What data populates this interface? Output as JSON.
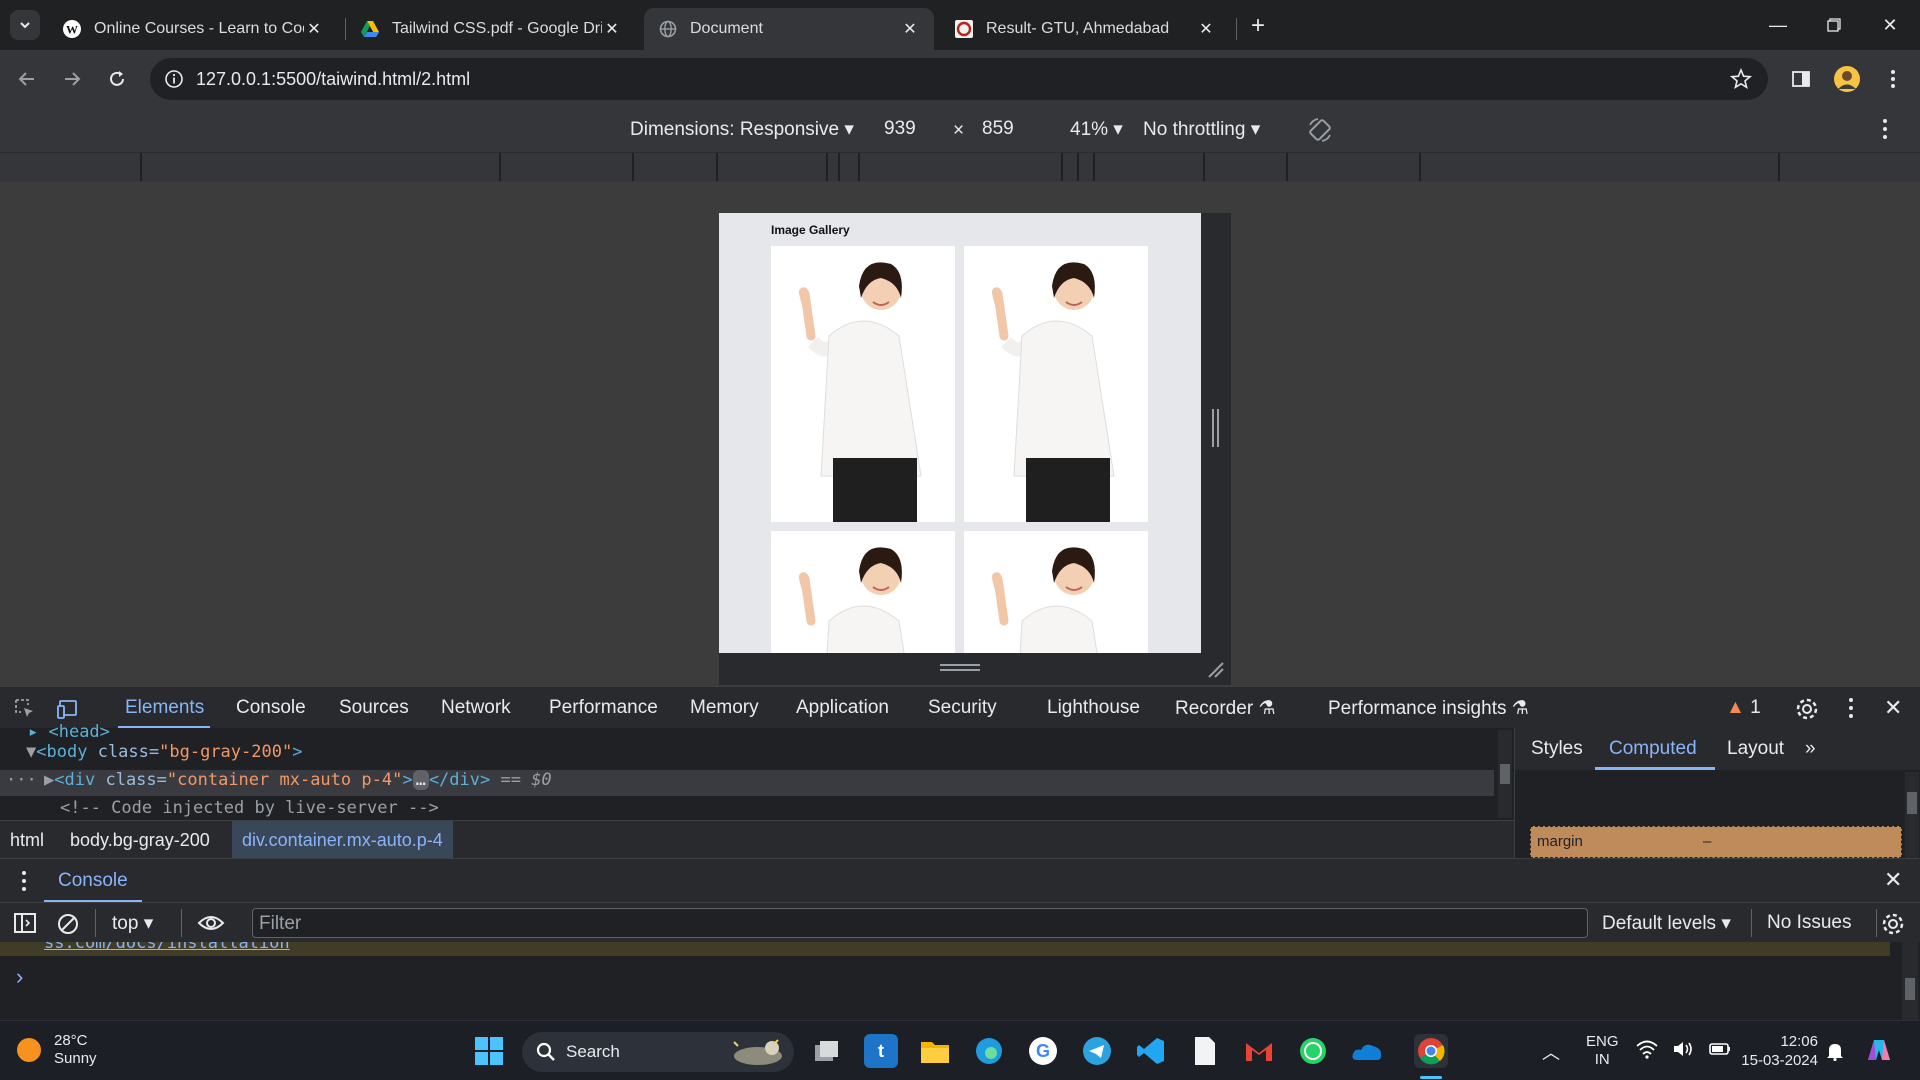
{
  "browser": {
    "tabs": [
      {
        "title": "Online Courses - Learn to Code",
        "favicon": "wordpress-icon"
      },
      {
        "title": "Tailwind CSS.pdf - Google Drive",
        "favicon": "google-drive-icon"
      },
      {
        "title": "Document",
        "favicon": "globe-icon",
        "active": true
      },
      {
        "title": "Result- GTU, Ahmedabad",
        "favicon": "gtu-icon"
      }
    ],
    "url": "127.0.0.1:5500/taiwind.html/2.html"
  },
  "device_toolbar": {
    "dimensions": "Dimensions: Responsive",
    "width": "939",
    "times": "×",
    "height": "859",
    "zoom": "41%",
    "throttling": "No throttling"
  },
  "page": {
    "title": "Image Gallery"
  },
  "devtools": {
    "tabs": [
      "Elements",
      "Console",
      "Sources",
      "Network",
      "Performance",
      "Memory",
      "Application",
      "Security",
      "Lighthouse",
      "Recorder",
      "Performance insights"
    ],
    "active_tab": "Elements",
    "issues_count": "1",
    "elements": {
      "line0": "<head>",
      "body_tag": "body",
      "body_class_attr": "class",
      "body_class_val": "\"bg-gray-200\"",
      "div_tag": "div",
      "div_class_val": "\"container mx-auto p-4\"",
      "div_close": "</div>",
      "sel_marker": "== $0",
      "comment": "<!-- Code injected by live-server -->"
    },
    "breadcrumbs": [
      "html",
      "body.bg-gray-200",
      "div.container.mx-auto.p-4"
    ],
    "side_tabs": [
      "Styles",
      "Computed",
      "Layout"
    ],
    "side_active": "Computed",
    "box_model": {
      "label": "margin",
      "value": "–"
    },
    "drawer_title": "Console",
    "console": {
      "context": "top",
      "filter_placeholder": "Filter",
      "levels": "Default levels",
      "issues": "No Issues",
      "link_text": "ss.com/docs/installation",
      "prompt": "›"
    }
  },
  "taskbar": {
    "weather_temp": "28°C",
    "weather_desc": "Sunny",
    "search_label": "Search",
    "lang_top": "ENG",
    "lang_bottom": "IN",
    "time": "12:06",
    "date": "15-03-2024"
  },
  "colors": {
    "accent": "#8ab4f8",
    "warning": "#f28b54"
  }
}
